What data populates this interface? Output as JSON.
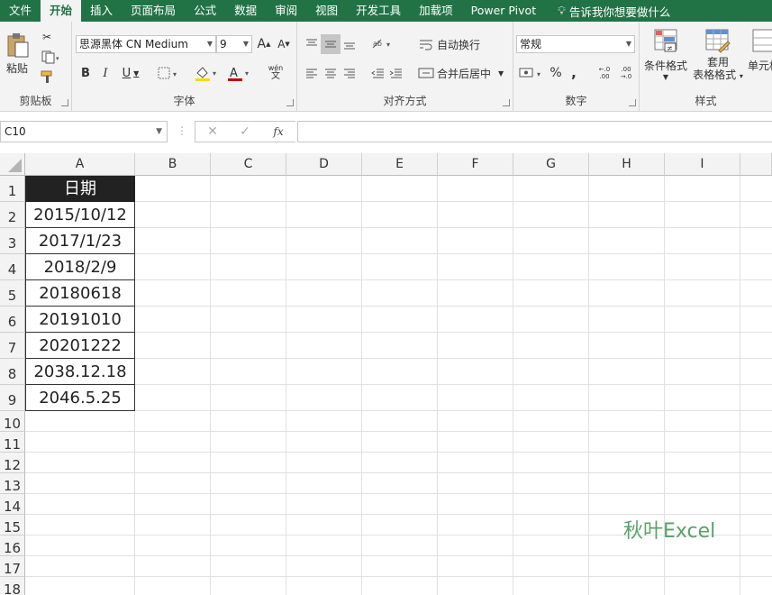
{
  "tabs": [
    "文件",
    "开始",
    "插入",
    "页面布局",
    "公式",
    "数据",
    "审阅",
    "视图",
    "开发工具",
    "加载项",
    "Power Pivot"
  ],
  "active_tab": "开始",
  "tell_me": "告诉我你想要做什么",
  "ribbon": {
    "clipboard": {
      "label": "剪贴板",
      "paste": "粘贴"
    },
    "font": {
      "label": "字体",
      "name": "思源黑体 CN Medium",
      "size": "9",
      "bold": "B",
      "italic": "I",
      "underline": "U",
      "grow": "A",
      "shrink": "A",
      "font_color": "A",
      "wen": "wén",
      "wen2": "文"
    },
    "align": {
      "label": "对齐方式",
      "wrap": "自动换行",
      "merge": "合并后居中"
    },
    "number": {
      "label": "数字",
      "format": "常规",
      "percent": "%",
      "comma": ",",
      "inc_decimal": "←.0 .00",
      "dec_decimal": ".00 →.0"
    },
    "styles": {
      "label": "样式",
      "cond": "条件格式",
      "table_line1": "套用",
      "table_line2": "表格格式",
      "cell": "单元格"
    }
  },
  "formula_bar": {
    "name_box": "C10",
    "fx": "fx",
    "cancel": "✕",
    "enter": "✓",
    "value": ""
  },
  "columns": [
    "A",
    "B",
    "C",
    "D",
    "E",
    "F",
    "G",
    "H",
    "I"
  ],
  "rows": [
    "1",
    "2",
    "3",
    "4",
    "5",
    "6",
    "7",
    "8",
    "9",
    "10",
    "11",
    "12",
    "13",
    "14",
    "15",
    "16",
    "17",
    "18"
  ],
  "cells": {
    "header": "日期",
    "values": [
      "2015/10/12",
      "2017/1/23",
      "2018/2/9",
      "20180618",
      "20191010",
      "20201222",
      "2038.12.18",
      "2046.5.25"
    ]
  },
  "watermark": "秋叶Excel",
  "colors": {
    "accent": "#217346",
    "header_fill": "#222222",
    "watermark": "#5aa06b"
  }
}
